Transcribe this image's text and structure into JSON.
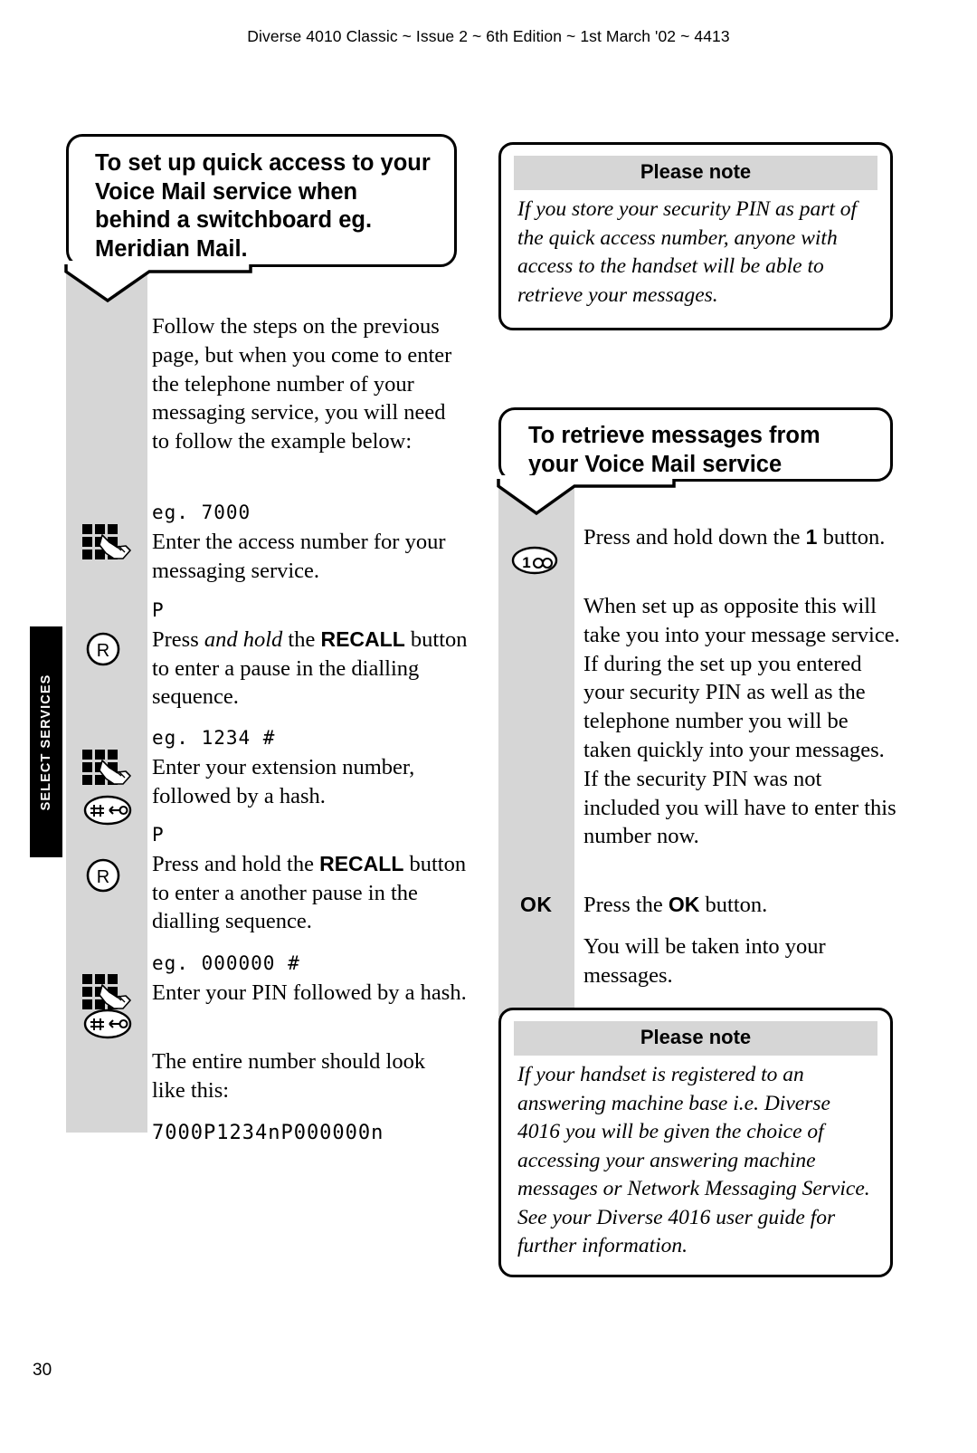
{
  "header": {
    "running_head": "Diverse 4010 Classic ~ Issue 2 ~ 6th Edition ~ 1st March '02 ~ 4413"
  },
  "side_tab": {
    "label": "SELECT SERVICES"
  },
  "folio": {
    "page_number": "30"
  },
  "left_column": {
    "callout": {
      "line1": "To set up quick access to your",
      "line2": "Voice Mail service when",
      "line3": "behind a switchboard eg.",
      "line4": "Meridian Mail."
    },
    "intro_paragraph": "Follow the steps on the previous page, but when you come to enter the telephone number of your messaging service, you will need to follow the example below:",
    "steps": [
      {
        "icon": "keypad-press-icon",
        "lcd": "eg. 7000",
        "text": "Enter the access number for your messaging service."
      },
      {
        "icon": "recall-button-icon",
        "icon_label": "R",
        "lcd": "P",
        "text_parts": [
          "Press ",
          "and hold",
          " the ",
          "RECALL",
          " button to enter a pause in the dialling sequence."
        ]
      },
      {
        "icon": "keypad-press-icon",
        "icon2": "hash-key-icon",
        "lcd": "eg. 1234  #",
        "text": "Enter your extension number, followed by a hash."
      },
      {
        "icon": "recall-button-icon",
        "icon_label": "R",
        "lcd": "P",
        "text_parts": [
          "Press and hold the ",
          "RECALL",
          " button to enter a another pause in the dialling sequence."
        ]
      },
      {
        "icon": "keypad-press-icon",
        "icon2": "hash-key-icon",
        "lcd": "eg. 000000  #",
        "text": "Enter your PIN followed by a hash."
      }
    ],
    "closing_paragraph": "The entire number should look like this:",
    "full_number_lcd": "7000P1234nP000000n"
  },
  "right_column": {
    "note_top": {
      "heading": "Please note",
      "body": "If you store your security PIN as part of the quick access number, anyone with access to the handset will be able to retrieve your messages."
    },
    "callout": {
      "line1": "To retrieve messages from",
      "line2": "your Voice Mail service"
    },
    "steps": [
      {
        "icon": "voicemail-one-button-icon",
        "icon_label": "1",
        "text_parts": [
          "Press and hold down the ",
          "1",
          " button."
        ]
      },
      {
        "icon": "none",
        "text": "When set up as opposite this will take you into your message service. If during the set up you entered your security PIN as well as the telephone number you will be taken quickly into your messages. If the security PIN was not included you will have to enter this number now."
      },
      {
        "icon": "ok-button-icon",
        "icon_label": "OK",
        "text_parts": [
          "Press the ",
          "OK",
          " button."
        ]
      },
      {
        "icon": "none",
        "text": "You will be taken into your messages."
      }
    ],
    "note_bottom": {
      "heading": "Please note",
      "body": "If your handset is registered to an answering machine base i.e. Diverse 4016 you will be given the choice of accessing your answering machine messages or Network Messaging Service. See your Diverse 4016 user guide for further information."
    }
  },
  "colors": {
    "gutter_grey": "#d6d6d6",
    "tab_black": "#000000",
    "note_head_grey": "#d6d6d6"
  }
}
